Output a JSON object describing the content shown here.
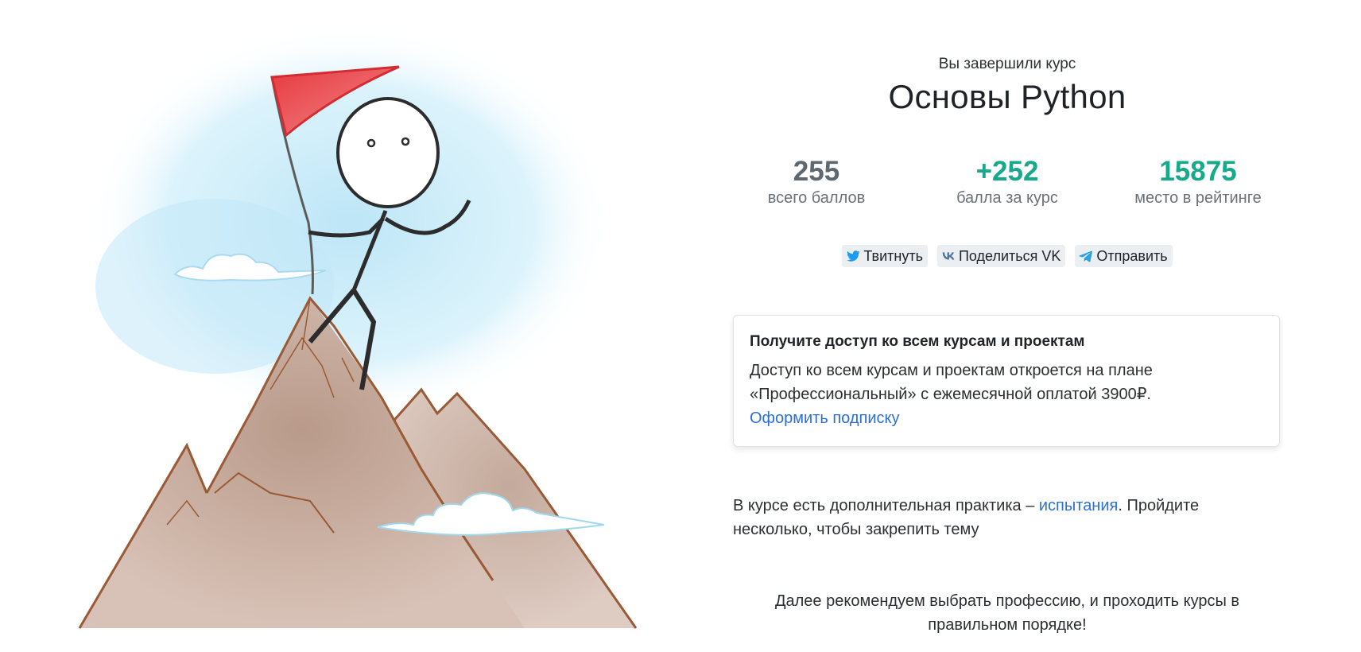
{
  "header": {
    "subtitle": "Вы завершили курс",
    "course_title": "Основы Python"
  },
  "stats": [
    {
      "value": "255",
      "label": "всего баллов",
      "color": "#5f6770"
    },
    {
      "value": "+252",
      "label": "балла за курс",
      "color": "#16a98a"
    },
    {
      "value": "15875",
      "label": "место в рейтинге",
      "color": "#16a98a"
    }
  ],
  "share": {
    "twitter_label": "Твитнуть",
    "vk_label": "Поделиться VK",
    "telegram_label": "Отправить"
  },
  "promo": {
    "title": "Получите доступ ко всем курсам и проектам",
    "text": "Доступ ко всем курсам и проектам откроется на плане «Профессиональный» с ежемесячной оплатой 3900₽.",
    "link_label": "Оформить подписку"
  },
  "practice": {
    "text_before": "В курсе есть дополнительная практика – ",
    "link_label": "испытания",
    "text_after": ". Пройдите несколько, чтобы закрепить тему"
  },
  "recommendation": "Далее рекомендуем выбрать профессию, и проходить курсы в правильном порядке!",
  "colors": {
    "accent_green": "#16a98a",
    "link_blue": "#2a6fdb",
    "flag_red": "#e8464c",
    "mountain": "#c6a99a",
    "sky": "#bfe6f5"
  }
}
